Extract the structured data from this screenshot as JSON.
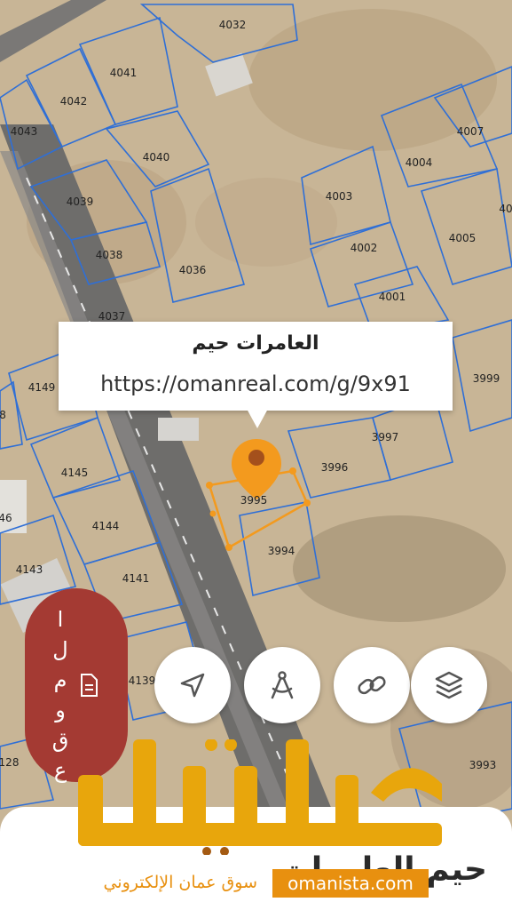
{
  "map": {
    "parcels": [
      "4032",
      "4041",
      "4042",
      "4043",
      "4040",
      "4039",
      "4038",
      "4036",
      "4037",
      "4007",
      "4004",
      "4003",
      "4002",
      "4005",
      "4001",
      "3999",
      "3997",
      "3996",
      "3995",
      "3994",
      "4149",
      "4145",
      "4144",
      "4143",
      "4141",
      "4139",
      "3993",
      "46",
      "128",
      "8",
      "40"
    ]
  },
  "popup": {
    "title": "العامرات حيم",
    "link": "https://omanreal.com/g/9x91"
  },
  "side_pill": {
    "letters": [
      "ا",
      "ل",
      "م",
      "و",
      "ق",
      "ع"
    ],
    "icon": "document-icon"
  },
  "toolbar": {
    "buttons": [
      {
        "name": "navigate-button",
        "icon": "navigation-arrow-icon"
      },
      {
        "name": "measure-button",
        "icon": "compass-icon"
      },
      {
        "name": "share-link-button",
        "icon": "link-icon"
      },
      {
        "name": "layers-button",
        "icon": "layers-icon"
      }
    ]
  },
  "sheet": {
    "title": "حيم العامرات"
  },
  "watermark": {
    "logo": "عمانيستا",
    "site": "omanista.com",
    "tagline": "سوق عمان الإلكتروني"
  },
  "colors": {
    "parcel_lines": "#2f6fd6",
    "selected_parcel": "#f39a1e",
    "pill": "#a43a33",
    "watermark": "#e8900f"
  }
}
